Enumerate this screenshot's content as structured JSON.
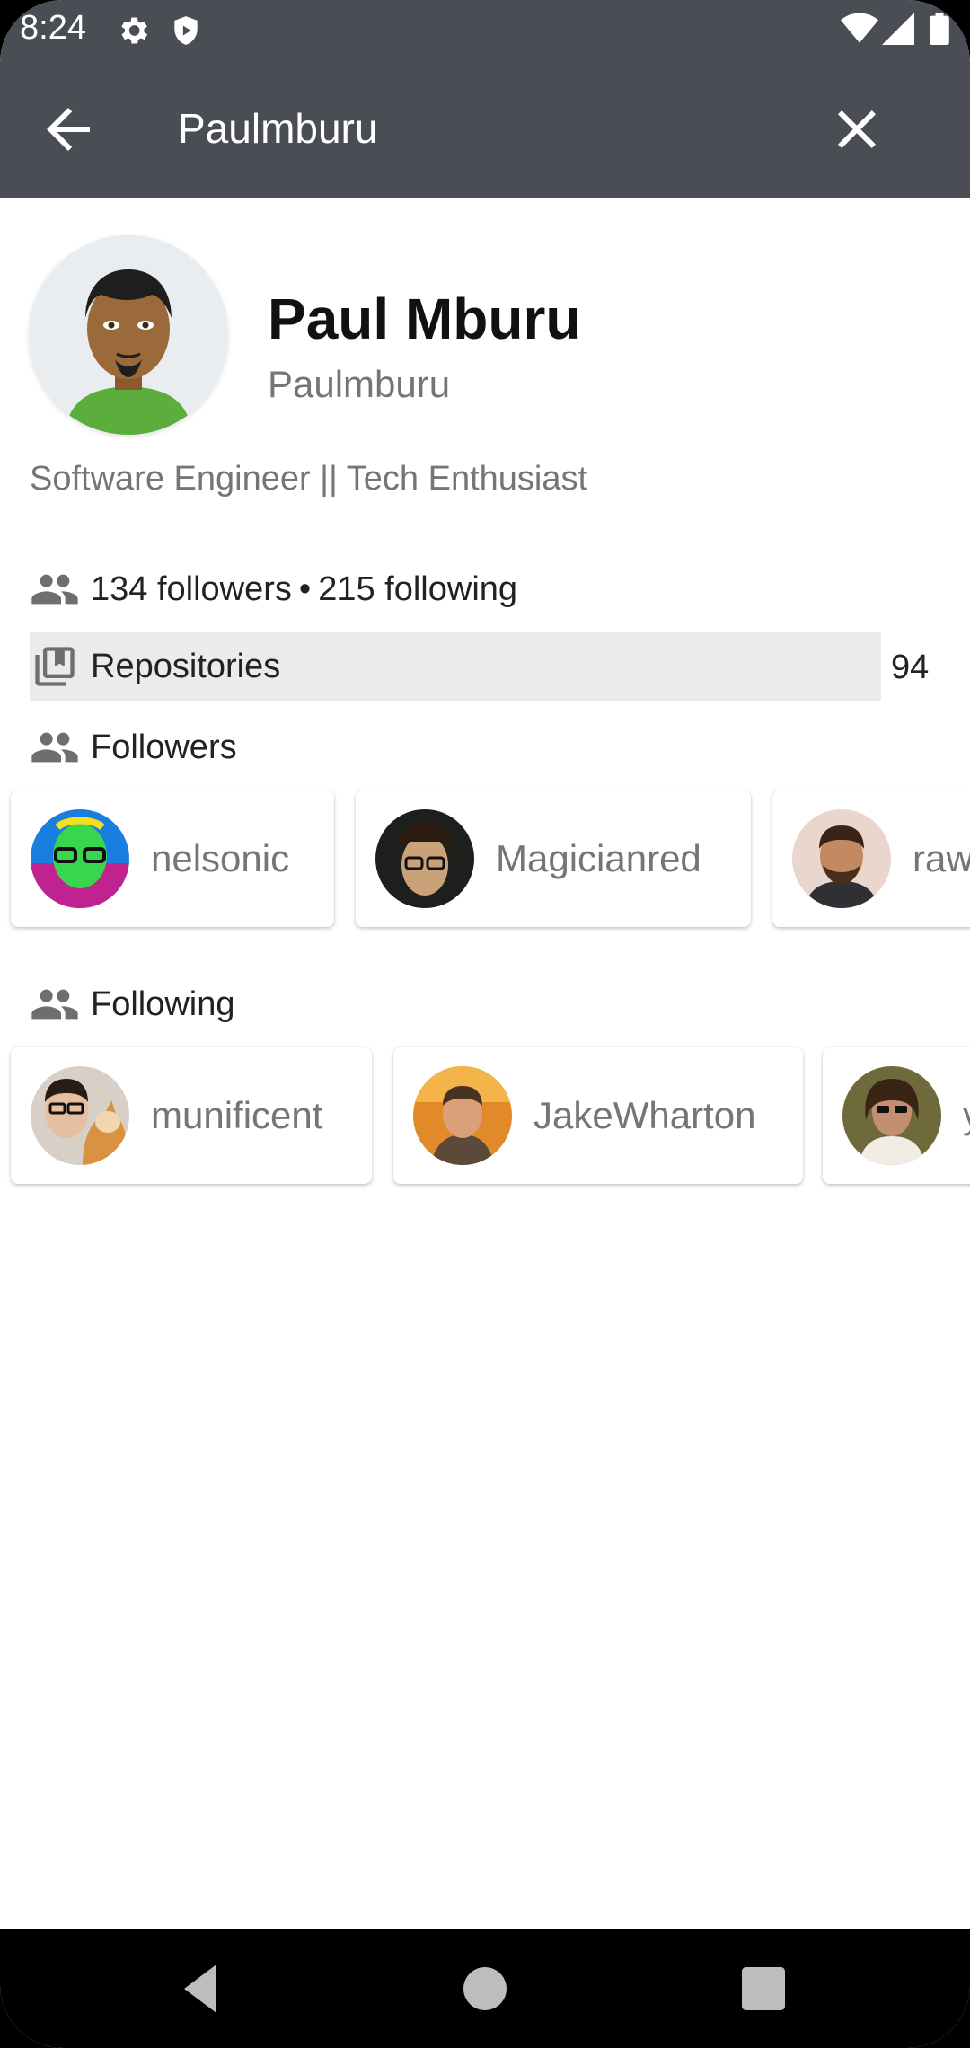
{
  "status": {
    "time": "8:24"
  },
  "app_bar": {
    "search_text": "Paulmburu"
  },
  "profile": {
    "name": "Paul Mburu",
    "login": "Paulmburu",
    "bio": "Software Engineer || Tech Enthusiast",
    "followers_text": "134 followers",
    "separator": "•",
    "following_text": "215 following"
  },
  "repositories": {
    "label": "Repositories",
    "count": "94"
  },
  "followers": {
    "title": "Followers",
    "items": [
      {
        "login": "nelsonic"
      },
      {
        "login": "Magicianred"
      },
      {
        "login": "raw"
      }
    ]
  },
  "following": {
    "title": "Following",
    "items": [
      {
        "login": "munificent"
      },
      {
        "login": "JakeWharton"
      },
      {
        "login": "y"
      }
    ]
  },
  "colors": {
    "app_bar": "#4a4d53",
    "repo_bar": "#ebebeb",
    "secondary_text": "#757575"
  },
  "icons": [
    "settings-icon",
    "shield-icon",
    "wifi-icon",
    "signal-icon",
    "battery-icon",
    "back-arrow-icon",
    "close-icon",
    "people-icon",
    "repository-icon",
    "nav-back-icon",
    "nav-home-icon",
    "nav-recents-icon"
  ]
}
